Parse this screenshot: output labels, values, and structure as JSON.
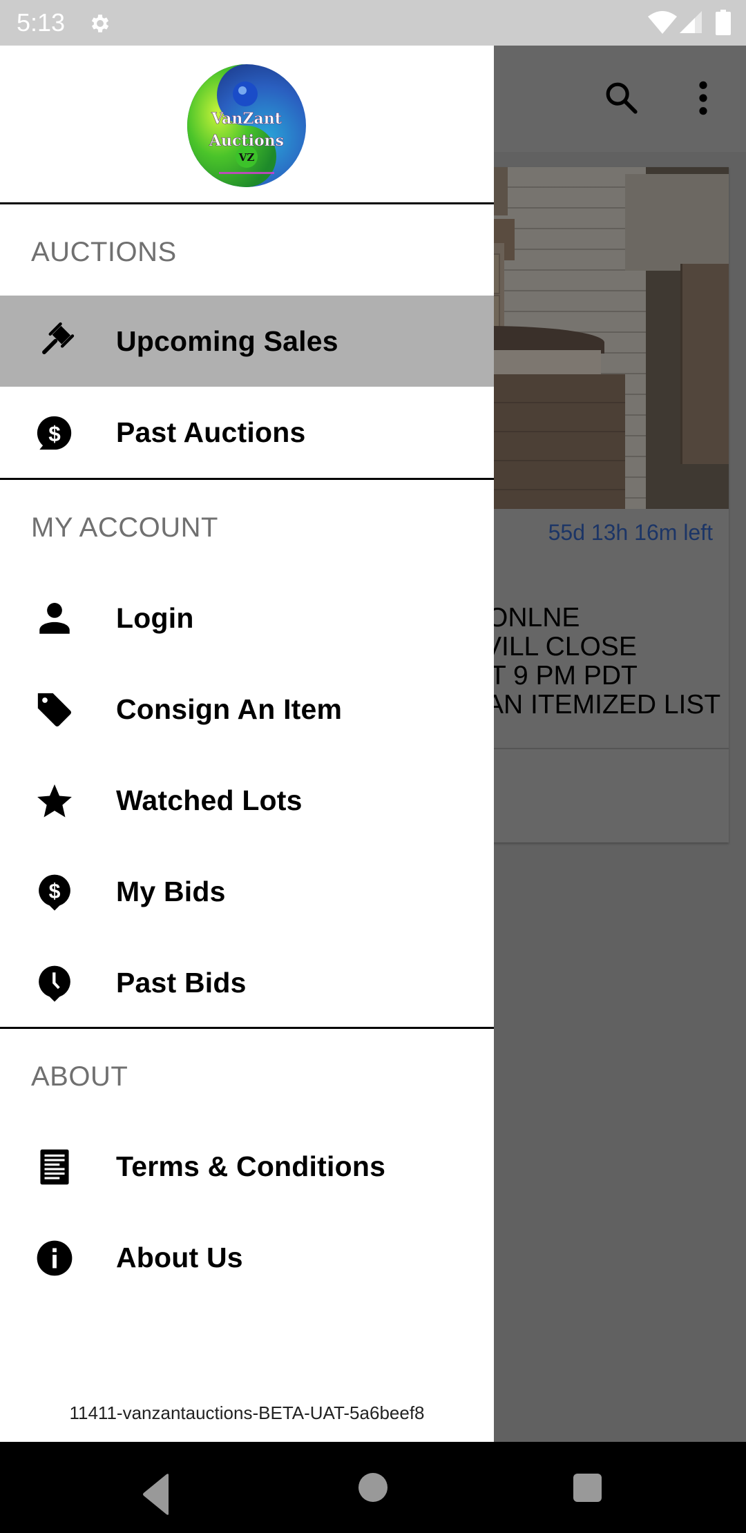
{
  "status_bar": {
    "time": "5:13",
    "icons": [
      "settings-gear-icon",
      "wifi-icon",
      "cellular-signal-icon",
      "battery-icon"
    ]
  },
  "background_app": {
    "toolbar": {
      "actions": [
        "search-icon",
        "overflow-menu-icon"
      ]
    },
    "auction_card": {
      "time_left": "55d 13h 16m left",
      "description_visible_lines": [
        "ONLNE",
        "VILL CLOSE",
        "T 9 PM PDT",
        "AN ITEMIZED LIST"
      ],
      "timer_color": "#1c3566"
    }
  },
  "drawer": {
    "logo": {
      "line1": "VanZant",
      "line2": "Auctions",
      "badge": "VZ"
    },
    "sections": [
      {
        "header": "AUCTIONS",
        "items": [
          {
            "label": "Upcoming Sales",
            "icon": "gavel-icon",
            "active": true
          },
          {
            "label": "Past Auctions",
            "icon": "dollar-chat-bubble-icon",
            "active": false
          }
        ]
      },
      {
        "header": "MY ACCOUNT",
        "items": [
          {
            "label": "Login",
            "icon": "person-icon",
            "active": false
          },
          {
            "label": "Consign An Item",
            "icon": "tag-icon",
            "active": false
          },
          {
            "label": "Watched Lots",
            "icon": "star-icon",
            "active": false
          },
          {
            "label": "My Bids",
            "icon": "dollar-pin-icon",
            "active": false
          },
          {
            "label": "Past Bids",
            "icon": "clock-pin-icon",
            "active": false
          }
        ]
      },
      {
        "header": "ABOUT",
        "items": [
          {
            "label": "Terms & Conditions",
            "icon": "document-icon",
            "active": false
          },
          {
            "label": "About Us",
            "icon": "info-icon",
            "active": false
          }
        ]
      }
    ],
    "version": "11411-vanzantauctions-BETA-UAT-5a6beef8",
    "active_highlight_color": "#b0b0b0"
  },
  "nav_bar": {
    "buttons": [
      "back-button",
      "home-button",
      "recents-button"
    ]
  }
}
